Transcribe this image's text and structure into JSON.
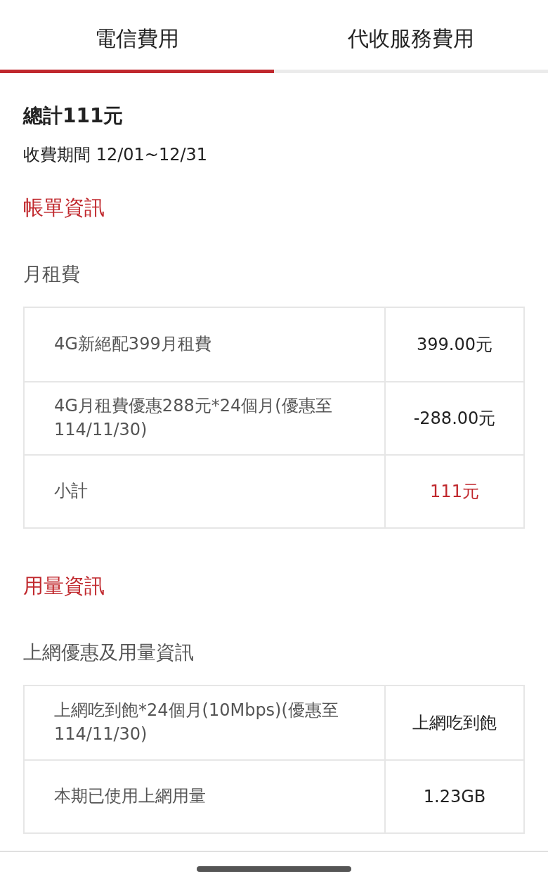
{
  "tabs": [
    {
      "label": "電信費用",
      "selected": true
    },
    {
      "label": "代收服務費用",
      "selected": false
    }
  ],
  "summary": {
    "total": "總計111元",
    "period": "收費期間 12/01~12/31"
  },
  "sections": [
    {
      "title": "帳單資訊",
      "groups": [
        {
          "title": "月租費",
          "rows": [
            {
              "item": "4G新絕配399月租費",
              "value": "399.00元",
              "highlight": false
            },
            {
              "item": "4G月租費優惠288元*24個月(優惠至114/11/30)",
              "value": "-288.00元",
              "highlight": false
            },
            {
              "item": "小計",
              "value": "111元",
              "highlight": true
            }
          ]
        }
      ]
    },
    {
      "title": "用量資訊",
      "groups": [
        {
          "title": "上網優惠及用量資訊",
          "rows": [
            {
              "item": "上網吃到飽*24個月(10Mbps)(優惠至114/11/30)",
              "value": "上網吃到飽",
              "highlight": false
            },
            {
              "item": "本期已使用上網用量",
              "value": "1.23GB",
              "highlight": false
            }
          ]
        }
      ]
    }
  ]
}
